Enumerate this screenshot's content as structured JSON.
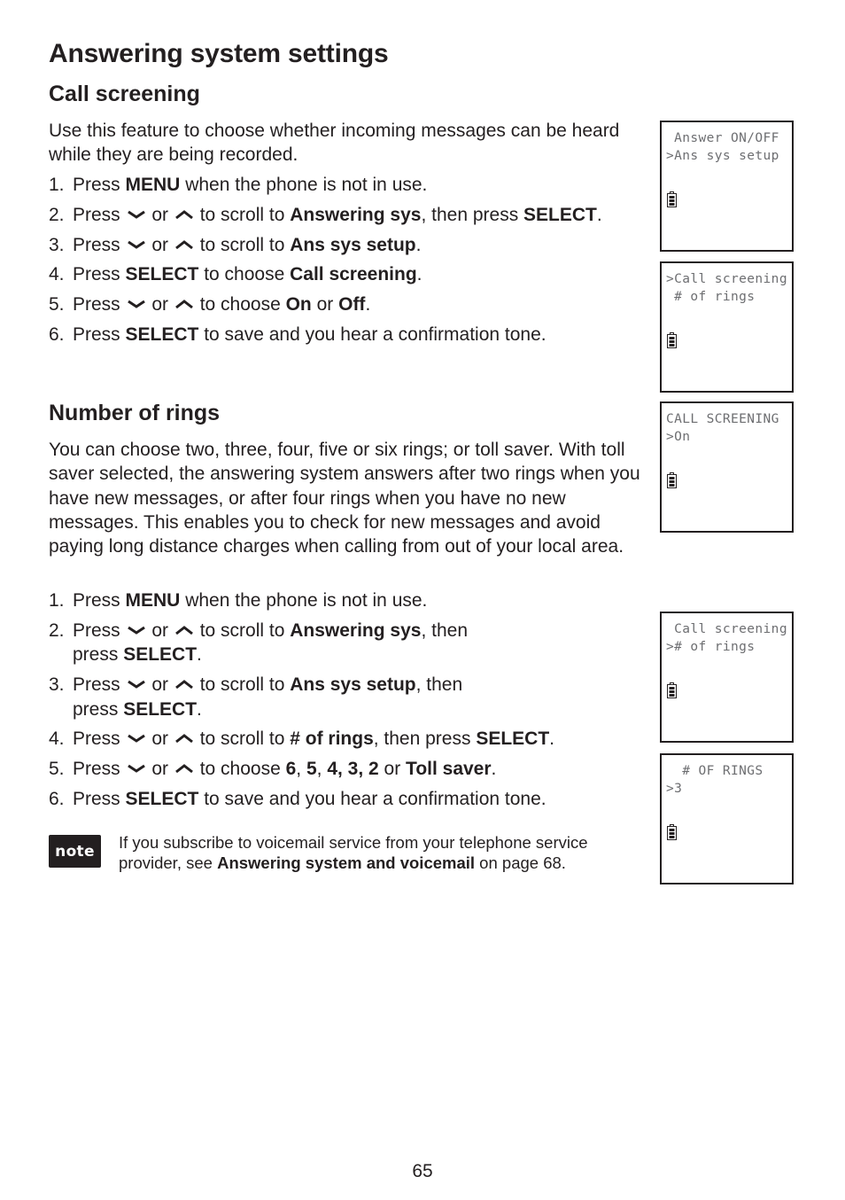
{
  "page_title": "Answering system settings",
  "sections": {
    "call_screening": {
      "title": "Call screening",
      "intro": "Use this feature to choose whether incoming messages can be heard while they are being recorded.",
      "steps": [
        {
          "num": "1.",
          "parts": [
            {
              "t": "Press "
            },
            {
              "t": "MENU",
              "b": true
            },
            {
              "t": " when the phone is not in use."
            }
          ]
        },
        {
          "num": "2.",
          "parts": [
            {
              "t": "Press "
            },
            {
              "icon": "down"
            },
            {
              "t": " or "
            },
            {
              "icon": "up"
            },
            {
              "t": " to scroll to "
            },
            {
              "t": "Answering sys",
              "b": true
            },
            {
              "t": ", then press "
            },
            {
              "t": "SELECT",
              "b": true
            },
            {
              "t": "."
            }
          ]
        },
        {
          "num": "3.",
          "parts": [
            {
              "t": "Press "
            },
            {
              "icon": "down"
            },
            {
              "t": " or "
            },
            {
              "icon": "up"
            },
            {
              "t": " to scroll to "
            },
            {
              "t": "Ans sys setup",
              "b": true
            },
            {
              "t": "."
            }
          ]
        },
        {
          "num": "4.",
          "parts": [
            {
              "t": "Press "
            },
            {
              "t": "SELECT",
              "b": true
            },
            {
              "t": " to choose "
            },
            {
              "t": "Call screening",
              "b": true
            },
            {
              "t": "."
            }
          ]
        },
        {
          "num": "5.",
          "parts": [
            {
              "t": "Press "
            },
            {
              "icon": "down"
            },
            {
              "t": " or "
            },
            {
              "icon": "up"
            },
            {
              "t": " to choose "
            },
            {
              "t": "On",
              "b": true
            },
            {
              "t": " or "
            },
            {
              "t": "Off",
              "b": true
            },
            {
              "t": "."
            }
          ]
        },
        {
          "num": "6.",
          "parts": [
            {
              "t": "Press "
            },
            {
              "t": "SELECT",
              "b": true
            },
            {
              "t": " to save and you hear a confirmation tone."
            }
          ]
        }
      ]
    },
    "number_of_rings": {
      "title": "Number of rings",
      "intro": "You can choose two, three, four, five or six rings; or toll saver. With toll saver selected, the answering system answers after two rings when you have new messages, or after four rings when you have no new messages. This enables you to check for new messages and avoid paying long distance charges when calling from out of your local area.",
      "steps": [
        {
          "num": "1.",
          "parts": [
            {
              "t": "Press "
            },
            {
              "t": "MENU",
              "b": true
            },
            {
              "t": " when the phone is not in use."
            }
          ]
        },
        {
          "num": "2.",
          "parts": [
            {
              "t": "Press "
            },
            {
              "icon": "down"
            },
            {
              "t": " or "
            },
            {
              "icon": "up"
            },
            {
              "t": " to scroll to "
            },
            {
              "t": "Answering sys",
              "b": true
            },
            {
              "t": ", then"
            },
            {
              "br": true
            },
            {
              "t": "press "
            },
            {
              "t": "SELECT",
              "b": true
            },
            {
              "t": "."
            }
          ]
        },
        {
          "num": "3.",
          "parts": [
            {
              "t": "Press "
            },
            {
              "icon": "down"
            },
            {
              "t": " or "
            },
            {
              "icon": "up"
            },
            {
              "t": " to scroll to "
            },
            {
              "t": "Ans sys setup",
              "b": true
            },
            {
              "t": ", then"
            },
            {
              "br": true
            },
            {
              "t": "press "
            },
            {
              "t": "SELECT",
              "b": true
            },
            {
              "t": "."
            }
          ]
        },
        {
          "num": "4.",
          "parts": [
            {
              "t": "Press "
            },
            {
              "icon": "down"
            },
            {
              "t": " or "
            },
            {
              "icon": "up"
            },
            {
              "t": " to scroll to "
            },
            {
              "t": "# of rings",
              "b": true
            },
            {
              "t": ", then press "
            },
            {
              "t": "SELECT",
              "b": true
            },
            {
              "t": "."
            }
          ]
        },
        {
          "num": "5.",
          "parts": [
            {
              "t": "Press "
            },
            {
              "icon": "down"
            },
            {
              "t": " or "
            },
            {
              "icon": "up"
            },
            {
              "t": " to choose "
            },
            {
              "t": "6",
              "b": true
            },
            {
              "t": ", "
            },
            {
              "t": "5",
              "b": true
            },
            {
              "t": ", "
            },
            {
              "t": "4, 3, 2",
              "b": true
            },
            {
              "t": " or "
            },
            {
              "t": "Toll saver",
              "b": true
            },
            {
              "t": "."
            }
          ]
        },
        {
          "num": "6.",
          "parts": [
            {
              "t": "Press "
            },
            {
              "t": "SELECT",
              "b": true
            },
            {
              "t": " to save and you hear a confirmation tone."
            }
          ]
        }
      ]
    }
  },
  "note": {
    "badge": "note",
    "parts": [
      {
        "t": "If you subscribe to voicemail service from your telephone service provider, see "
      },
      {
        "t": "Answering system and voicemail",
        "b": true
      },
      {
        "t": " on page 68."
      }
    ]
  },
  "lcd_screens": [
    {
      "line1": " Answer ON/OFF",
      "line2": ">Ans sys setup",
      "icon": "battery-icon"
    },
    {
      "line1": ">Call screening",
      "line2": " # of rings",
      "icon": "battery-icon"
    },
    {
      "line1": "CALL SCREENING",
      "line2": ">On",
      "icon": "battery-icon"
    },
    {
      "line1": " Call screening",
      "line2": "># of rings",
      "icon": "battery-icon"
    },
    {
      "line1": "  # OF RINGS",
      "line2": ">3",
      "icon": "battery-icon"
    }
  ],
  "page_number": "65"
}
